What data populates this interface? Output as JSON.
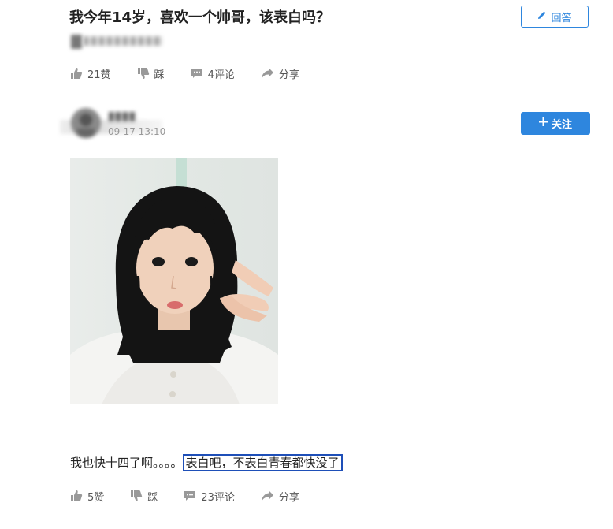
{
  "question": {
    "title": "我今年14岁，喜欢一个帅哥，该表白吗？",
    "reply_button": "回答"
  },
  "question_actions": {
    "like": "21赞",
    "dislike": "踩",
    "comments": "4评论",
    "share": "分享"
  },
  "answer": {
    "timestamp": "09-17 13:10",
    "follow_button": "关注",
    "text_plain": "我也快十四了啊。。。。",
    "text_highlighted": "表白吧，不表白青春都快没了"
  },
  "answer_actions": {
    "like": "5赞",
    "dislike": "踩",
    "comments": "23评论",
    "share": "分享"
  },
  "colors": {
    "accent": "#2e86de",
    "highlight_border": "#1e4fb8"
  },
  "icons": [
    "pencil-icon",
    "plus-icon",
    "thumbs-up-icon",
    "thumbs-down-icon",
    "comment-icon",
    "share-icon"
  ]
}
